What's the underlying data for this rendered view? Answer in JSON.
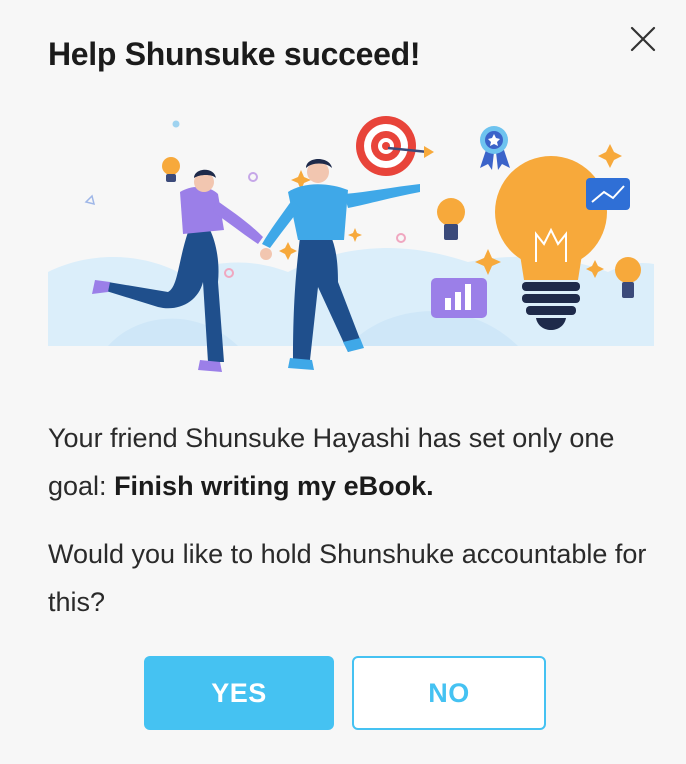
{
  "dialog": {
    "title": "Help Shunsuke succeed!",
    "message_prefix": "Your friend Shunsuke Hayashi  has set only one goal: ",
    "goal": "Finish writing my eBook.",
    "question": "Would you like to hold Shunshuke accountable for this?",
    "yes_label": "YES",
    "no_label": "NO",
    "close_icon": "close-icon"
  },
  "colors": {
    "accent": "#45c2f2",
    "title_text": "#1b1b1b",
    "body_text": "#2a2a2a",
    "background": "#f7f7f7",
    "bulb": "#f7a93b",
    "person_blue": "#3fa8e8",
    "person_purple": "#9b7fe8",
    "target_red": "#e8443a"
  }
}
